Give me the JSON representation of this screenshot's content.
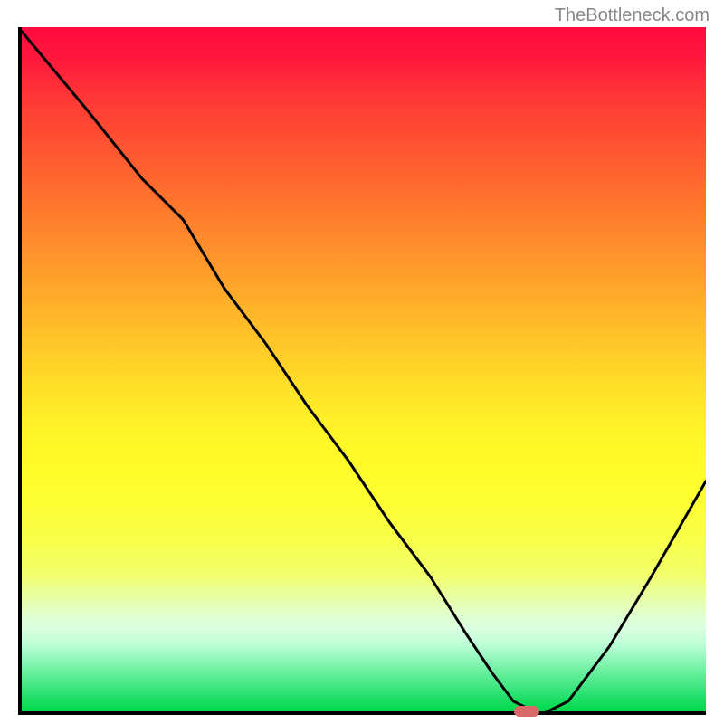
{
  "watermark": "TheBottleneck.com",
  "chart_data": {
    "type": "line",
    "title": "",
    "xlabel": "",
    "ylabel": "",
    "xlim": [
      0,
      100
    ],
    "ylim": [
      0,
      100
    ],
    "grid": false,
    "series": [
      {
        "name": "curve",
        "x": [
          0,
          10,
          18,
          24,
          30,
          36,
          42,
          48,
          54,
          60,
          65,
          69,
          72,
          76,
          80,
          86,
          92,
          100
        ],
        "values": [
          100,
          88,
          78,
          72,
          62,
          54,
          45,
          37,
          28,
          20,
          12,
          6,
          2,
          0,
          2,
          10,
          20,
          34
        ]
      }
    ],
    "marker": {
      "x": 74,
      "y": 0.5,
      "color": "#d86a6a"
    },
    "background_gradient": {
      "stops": [
        {
          "pos": 0,
          "color": "#ff0a3f"
        },
        {
          "pos": 50,
          "color": "#ffd628"
        },
        {
          "pos": 80,
          "color": "#f2ff6a"
        },
        {
          "pos": 100,
          "color": "#00d848"
        }
      ]
    }
  }
}
